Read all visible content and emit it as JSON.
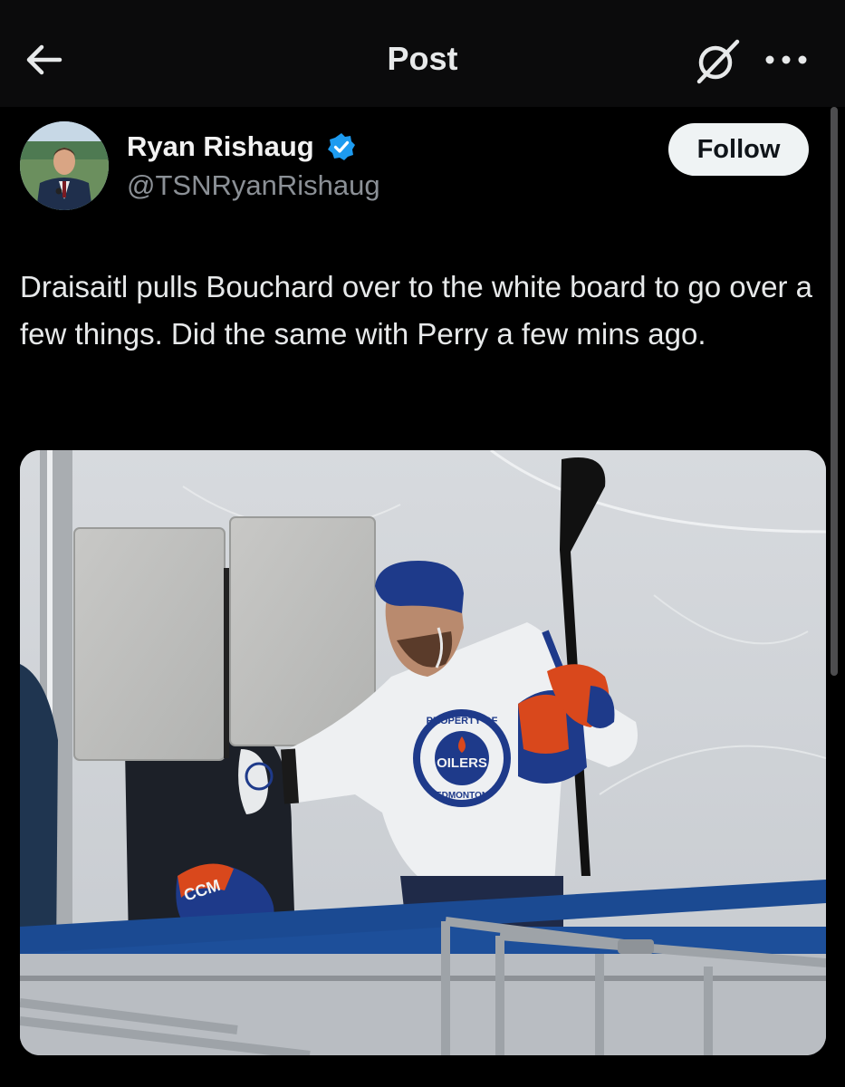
{
  "header": {
    "title": "Post",
    "back_icon": "arrow-left-icon",
    "grok_icon": "grok-icon",
    "more_icon": "more-horizontal-icon"
  },
  "author": {
    "name": "Ryan Rishaug",
    "handle": "@TSNRyanRishaug",
    "verified": true,
    "verified_color": "#1d9bf0"
  },
  "follow_button": {
    "label": "Follow"
  },
  "post": {
    "text": "Draisaitl pulls Bouchard over to the white board to go over a few things.  Did the same with Perry a few mins ago."
  },
  "media": {
    "jersey_crest_top": "PROPERTY OF",
    "jersey_crest_main": "OILERS",
    "jersey_crest_bottom": "EDMONTON",
    "glove_brand": "CCM"
  },
  "colors": {
    "background": "#000000",
    "text": "#e7e9ea",
    "secondary_text": "#8b9096",
    "follow_bg": "#eff3f4",
    "oilers_blue": "#1e3a8a",
    "oilers_orange": "#d9481c"
  }
}
